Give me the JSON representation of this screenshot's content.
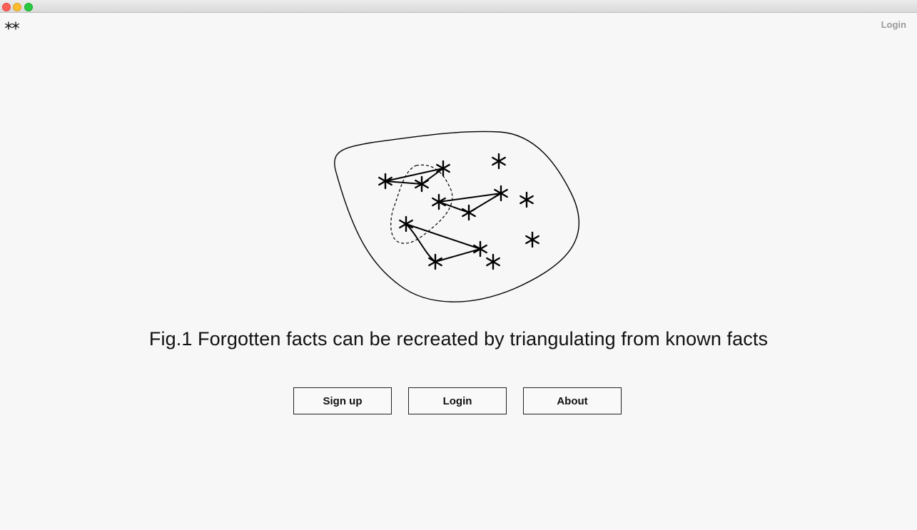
{
  "header": {
    "logo_icon": "two-stars-logo-icon",
    "login_label": "Login"
  },
  "figure": {
    "caption": "Fig.1 Forgotten facts can be recreated by triangulating from known facts",
    "illustration_icon": "star-constellation-blob-illustration"
  },
  "actions": {
    "signup_label": "Sign up",
    "login_label": "Login",
    "about_label": "About"
  },
  "colors": {
    "background": "#f7f7f7",
    "text": "#111111",
    "muted_link": "#9a9a9a"
  }
}
